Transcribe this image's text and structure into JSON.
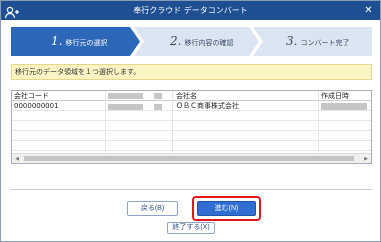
{
  "window": {
    "title": "奉行クラウド データコンバート",
    "app_icon": "user-plus-icon",
    "close_icon": "close-icon"
  },
  "steps": [
    {
      "number": "1.",
      "label": "移行元の選択",
      "active": true
    },
    {
      "number": "2.",
      "label": "移行内容の確認",
      "active": false
    },
    {
      "number": "3.",
      "label": "コンバート完了",
      "active": false
    }
  ],
  "instruction": "移行元のデータ領域を１つ選択します。",
  "table": {
    "columns": [
      "会社コード",
      "会社名",
      "作成日時"
    ],
    "rows": [
      {
        "code": "0000000001",
        "name": "ＯＢＣ商事株式会社"
      }
    ]
  },
  "buttons": {
    "back": "戻る(B)",
    "next": "進む(N)",
    "finish": "終了する(X)"
  },
  "colors": {
    "titlebar": "#1e4f93",
    "active_step": "#2d67b8",
    "inactive_step": "#dbe5f2",
    "highlight": "#e0181e",
    "primary_button": "#2f6fd1"
  }
}
